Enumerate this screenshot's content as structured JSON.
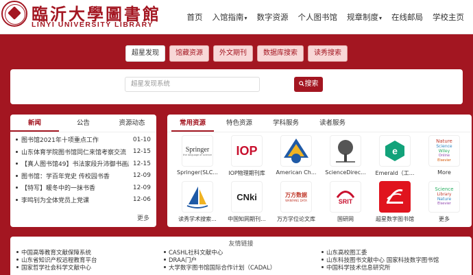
{
  "header": {
    "logo_cn": "臨沂大學圖書館",
    "logo_en": "LINYI UNIVERSITY LIBRARY",
    "nav": [
      "首页",
      "入馆指南",
      "数字资源",
      "个人图书馆",
      "规章制度",
      "在线邮局",
      "学校主页"
    ],
    "nav_dropdown_caret": "▾"
  },
  "search": {
    "tabs": [
      "超星发现",
      "馆藏资源",
      "外文期刊",
      "数据库搜索",
      "读秀搜索"
    ],
    "active_tab": 0,
    "placeholder": "超星发现系统",
    "button_label": "搜索",
    "button_icon": "search-icon"
  },
  "news": {
    "tabs": [
      "新闻",
      "公告",
      "资源动态"
    ],
    "active_tab": 0,
    "items": [
      {
        "title": "图书馆2021年十项重点工作",
        "date": "01-10"
      },
      {
        "title": "山东体育学院图书馆同仁来馆考察交流",
        "date": "12-15"
      },
      {
        "title": "【真人图书馆49】书法家段升沛御书画展",
        "date": "12-15"
      },
      {
        "title": "图书馆：学百年党史 传校园书香",
        "date": "12-09"
      },
      {
        "title": "【特写】暖冬中的一抹书香",
        "date": "12-09"
      },
      {
        "title": "李鸣钊为全体党员上党课",
        "date": "12-06"
      }
    ],
    "more": "更多"
  },
  "resources": {
    "tabs": [
      "常用资源",
      "特色资源",
      "学科服务",
      "读者服务"
    ],
    "active_tab": 0,
    "items": [
      {
        "label": "Springer(SLC...",
        "logo": "springer"
      },
      {
        "label": "IOP物理期刊库",
        "logo": "iop"
      },
      {
        "label": "American Ch...",
        "logo": "acs"
      },
      {
        "label": "ScienceDirec...",
        "logo": "sciencedirect"
      },
      {
        "label": "Emerald（工...",
        "logo": "emerald"
      },
      {
        "label": "More",
        "logo": "wordcloud"
      },
      {
        "label": "读秀学术搜索...",
        "logo": "duxiu"
      },
      {
        "label": "中国知网期刊...",
        "logo": "cnki"
      },
      {
        "label": "万方学位论文库",
        "logo": "wanfang"
      },
      {
        "label": "国研网",
        "logo": "srit"
      },
      {
        "label": "超星数字图书馆",
        "logo": "chaoxing"
      },
      {
        "label": "更多",
        "logo": "wordcloud"
      }
    ],
    "logo_texts": {
      "springer": "Springer",
      "springer_sub": "the language of science",
      "iop": "IOP",
      "cnki": "CNki",
      "wanfang": "万方数据",
      "wanfang_sub": "WANFANG DATA",
      "srit": "SRIT",
      "wordcloud_words": [
        "Nature",
        "Science",
        "Wiley",
        "Online",
        "Elsevier",
        "Library"
      ]
    }
  },
  "links": {
    "title": "友情链接",
    "items": [
      "中国高等教育文献保障系统",
      "CASHL社科文献中心",
      "山东高校图工委",
      "山东省知识产权远程教育平台",
      "DRAA门户",
      "山东科技图书文献中心 国家科技数字图书馆",
      "国家哲学社会科学文献中心",
      "大学数字图书馆国际合作计划（CADAL）",
      "中国科学技术信息研究所"
    ]
  },
  "colors": {
    "brand": "#a31621",
    "background": "#a31621",
    "panel": "#ffffff"
  }
}
